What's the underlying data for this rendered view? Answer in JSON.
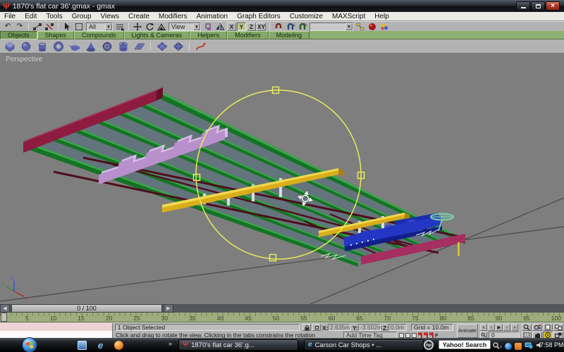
{
  "window": {
    "title": "1870's flat car 36'.gmax - gmax",
    "app_icon_glyph": "Ψ"
  },
  "menu": {
    "items": [
      "File",
      "Edit",
      "Tools",
      "Group",
      "Views",
      "Create",
      "Modifiers",
      "Animation",
      "Graph Editors",
      "Customize",
      "MAXScript",
      "Help"
    ]
  },
  "toolbar": {
    "selection_filter": "All",
    "reference_coordinate_system": "View",
    "named_selection_set": "",
    "axis_buttons": [
      {
        "name": "x",
        "label": "X"
      },
      {
        "name": "y",
        "label": "Y",
        "active": true
      },
      {
        "name": "z",
        "label": "Z"
      },
      {
        "name": "xy",
        "label": "XY"
      }
    ]
  },
  "tabs": {
    "items": [
      {
        "name": "objects",
        "label": "Objects",
        "active": true
      },
      {
        "name": "shapes",
        "label": "Shapes"
      },
      {
        "name": "compounds",
        "label": "Compounds"
      },
      {
        "name": "lights-cameras",
        "label": "Lights & Cameras"
      },
      {
        "name": "helpers",
        "label": "Helpers"
      },
      {
        "name": "modifiers",
        "label": "Modifiers"
      },
      {
        "name": "modeling",
        "label": "Modeling"
      }
    ]
  },
  "viewport": {
    "label": "Perspective"
  },
  "timeslider": {
    "value": "0 / 100",
    "left_arrow": "◀",
    "right_arrow": "▶"
  },
  "timeline": {
    "labels": [
      "5",
      "10",
      "15",
      "20",
      "25",
      "30",
      "35",
      "40",
      "45",
      "50",
      "55",
      "60",
      "65",
      "70",
      "75",
      "80",
      "85",
      "90",
      "95",
      "100"
    ]
  },
  "status": {
    "selection": "1 Object Selected",
    "prompt": "Click and drag to rotate the view. Clicking in the tabs constrains the rotation",
    "add_time_tag": "Add Time Tag",
    "x_label": "X:",
    "x_value": "2.635m",
    "y_label": "Y:",
    "y_value": "-3.502m",
    "z_label": "Z:",
    "z_value": "0.0m",
    "grid_label": "Grid = 10.0m",
    "animate_label": "Animate",
    "frame_value": "0",
    "key_filter_f": "F",
    "playback": [
      {
        "name": "go-to-start",
        "glyph": "«"
      },
      {
        "name": "previous-frame",
        "glyph": "‹"
      },
      {
        "name": "play",
        "glyph": "▶"
      },
      {
        "name": "next-frame",
        "glyph": "›"
      },
      {
        "name": "go-to-end",
        "glyph": "»"
      }
    ]
  },
  "taskbar": {
    "windows": [
      {
        "name": "gmax",
        "glyph": "Ψ",
        "label": "1870's flat car 36'.g...",
        "active": true
      },
      {
        "name": "ie",
        "glyph": "e",
        "label": "Carson Car Shops • ..."
      }
    ],
    "overflow_chevron": "»",
    "tray_chevron": "‹",
    "hp_logo": "hp",
    "search_text": "Yahoo! Search",
    "clock": "7:58 PM"
  },
  "colors": {
    "viewport_bg": "#7e7e7e",
    "grid_line": "#4a4a4a",
    "deck": "#64747c",
    "beam_green": "#157326",
    "beam_green_top": "#3aa84a",
    "end_beam_left": "#8e1b40",
    "end_beam_left_top": "#ad3a5e",
    "end_beam_left_side": "#661028",
    "bolster": "#b890cc",
    "bolster_top": "#d8bce6",
    "needle_yellow": "#d9ad1c",
    "needle_yellow_top": "#f2d74e",
    "needle_yellow_side": "#a8821a",
    "truss_rod": "#4f0d1d",
    "post_white": "#dde2e4",
    "truck_blue": "#2336c4",
    "truck_blue_dark": "#121f8a",
    "truck_blue_light": "#3a4cd8",
    "end_beam_right": "#a62e60",
    "end_beam_right_top": "#c44a7c",
    "brake_wheel": "#7fd0a8",
    "gizmo": "#e6ec5a"
  }
}
